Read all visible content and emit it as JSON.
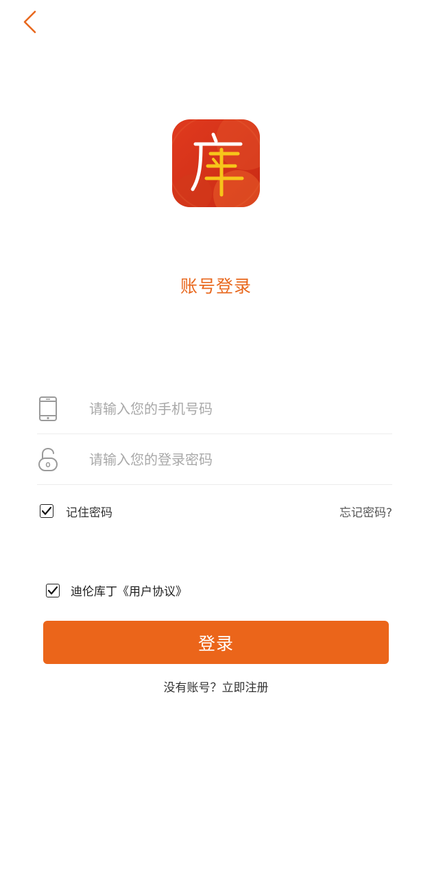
{
  "header": {
    "back_icon": "chevron-left-icon"
  },
  "logo": {
    "glyph": "库",
    "icon": "app-logo-icon"
  },
  "title": "账号登录",
  "form": {
    "phone": {
      "placeholder": "请输入您的手机号码",
      "value": "",
      "icon": "phone-icon"
    },
    "password": {
      "placeholder": "请输入您的登录密码",
      "value": "",
      "icon": "lock-icon"
    },
    "remember_label": "记住密码",
    "remember_checked": true,
    "forgot_label": "忘记密码?"
  },
  "agreement": {
    "label": "迪伦库丁《用户协议》",
    "checked": true
  },
  "login_button": "登录",
  "register_link": "没有账号？立即注册",
  "colors": {
    "accent": "#eb651a",
    "title": "#e8681e",
    "logo_bg": "#d9341c",
    "logo_glyph_accent": "#f7c51a"
  }
}
